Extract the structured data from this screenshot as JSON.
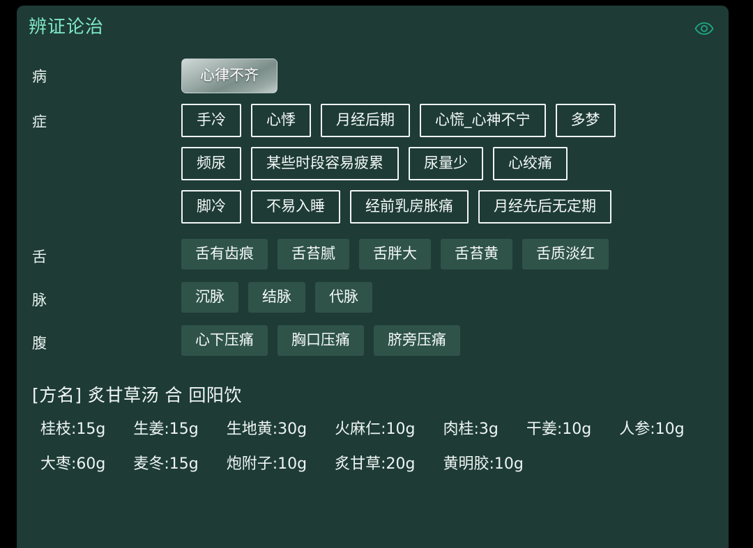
{
  "header": {
    "title": "辨证论治",
    "eye_icon": "eye-icon"
  },
  "sections": {
    "disease": {
      "label": "病",
      "chips": [
        "心律不齐"
      ]
    },
    "symptom": {
      "label": "症",
      "rows": [
        [
          "手冷",
          "心悸",
          "月经后期",
          "心慌_心神不宁",
          "多梦"
        ],
        [
          "频尿",
          "某些时段容易疲累",
          "尿量少",
          "心绞痛"
        ],
        [
          "脚冷",
          "不易入睡",
          "经前乳房胀痛",
          "月经先后无定期"
        ]
      ]
    },
    "tongue": {
      "label": "舌",
      "chips": [
        "舌有齿痕",
        "舌苔腻",
        "舌胖大",
        "舌苔黄",
        "舌质淡红"
      ]
    },
    "pulse": {
      "label": "脉",
      "chips": [
        "沉脉",
        "结脉",
        "代脉"
      ]
    },
    "abdomen": {
      "label": "腹",
      "chips": [
        "心下压痛",
        "胸口压痛",
        "脐旁压痛"
      ]
    }
  },
  "prescription": {
    "title": "[方名] 炙甘草汤  合  回阳饮",
    "herbs_row1": [
      "桂枝:15g",
      "生姜:15g",
      "生地黄:30g",
      "火麻仁:10g",
      "肉桂:3g",
      "干姜:10g",
      "人参:10g"
    ],
    "herbs_row2": [
      "大枣:60g",
      "麦冬:15g",
      "炮附子:10g",
      "炙甘草:20g",
      "黄明胶:10g"
    ]
  },
  "colors": {
    "page_background": "#000000",
    "card_background": "#1e3b36",
    "title_accent": "#7ee8c4",
    "chip_filled_background": "#2f5349",
    "text_primary": "#f1f7f5"
  }
}
